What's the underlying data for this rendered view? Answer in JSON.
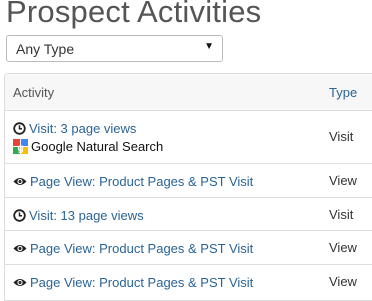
{
  "title": "Prospect Activities",
  "filter": {
    "selected": "Any Type"
  },
  "table": {
    "headers": {
      "activity": "Activity",
      "type": "Type"
    },
    "rows": [
      {
        "icon": "clock-icon",
        "activity": "Visit: 3 page views",
        "source": "Google Natural Search",
        "source_icon": "google-icon",
        "type": "Visit"
      },
      {
        "icon": "eye-icon",
        "activity": "Page View: Product Pages & PST Visit",
        "type": "View"
      },
      {
        "icon": "clock-icon",
        "activity": "Visit: 13 page views",
        "type": "Visit"
      },
      {
        "icon": "eye-icon",
        "activity": "Page View: Product Pages & PST Visit",
        "type": "View"
      },
      {
        "icon": "eye-icon",
        "activity": "Page View: Product Pages & PST Visit",
        "type": "View"
      }
    ]
  }
}
